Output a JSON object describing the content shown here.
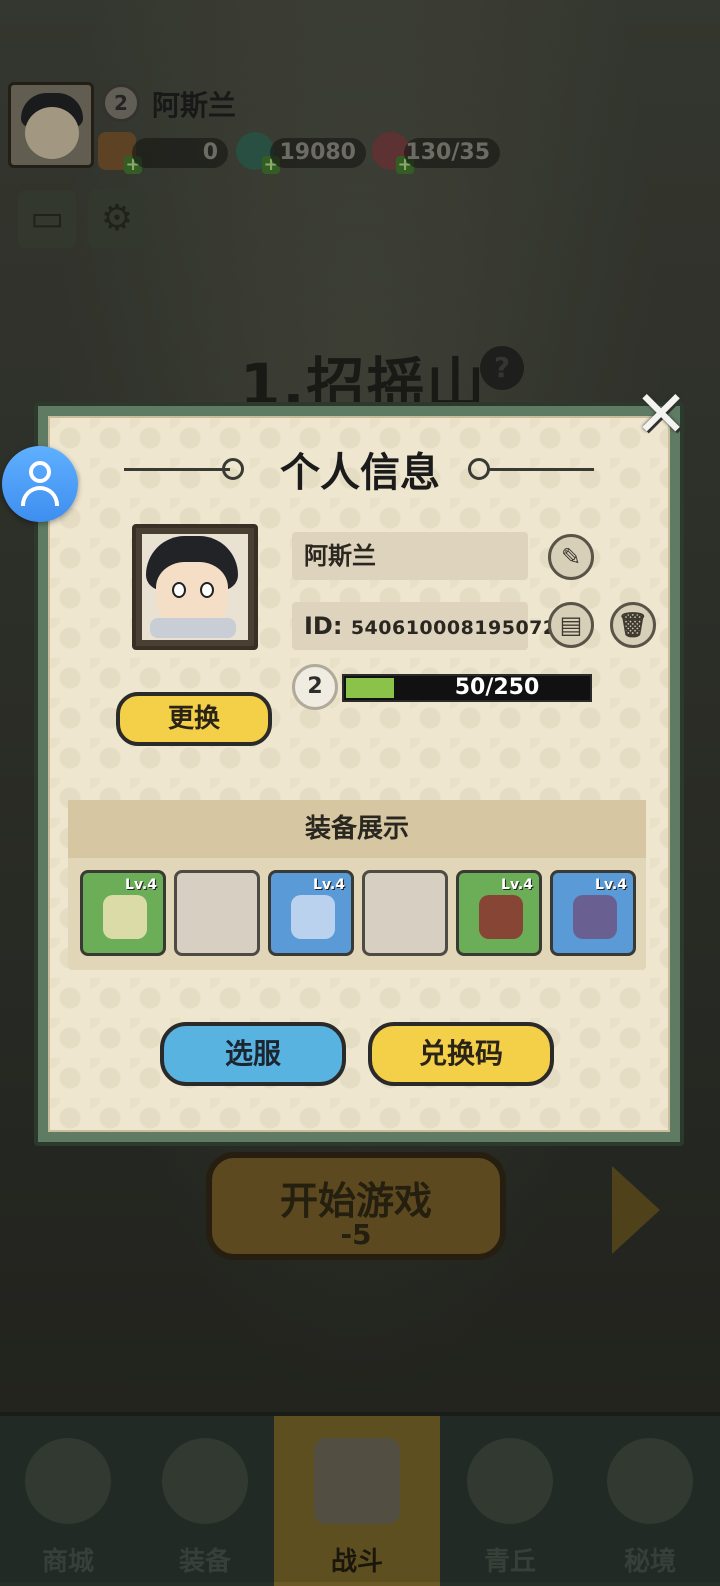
{
  "hud": {
    "player_name": "阿斯兰",
    "level": "2",
    "currency_1": "0",
    "currency_2": "19080",
    "stamina": "130/35"
  },
  "stage": {
    "title": "1.招摇山",
    "help_glyph": "?"
  },
  "start": {
    "label": "开始游戏",
    "cost": "-5"
  },
  "nav": [
    {
      "label": "商城"
    },
    {
      "label": "装备"
    },
    {
      "label": "战斗"
    },
    {
      "label": "青丘"
    },
    {
      "label": "秘境"
    }
  ],
  "dialog": {
    "title": "个人信息",
    "close_glyph": "✕",
    "name": "阿斯兰",
    "id_label": "ID:",
    "id_value": "540610008195072",
    "level": "2",
    "exp_text": "50/250",
    "exp_fraction": 0.2,
    "change_button": "更换",
    "equip_title": "装备展示",
    "slots": [
      {
        "rarity": "green",
        "level": "Lv.4",
        "icon": "scroll-item-icon"
      },
      {
        "rarity": "empty",
        "level": ""
      },
      {
        "rarity": "blue",
        "level": "Lv.4",
        "icon": "bracer-item-icon"
      },
      {
        "rarity": "empty",
        "level": ""
      },
      {
        "rarity": "green",
        "level": "Lv.4",
        "icon": "boots-item-icon"
      },
      {
        "rarity": "blue",
        "level": "Lv.4",
        "icon": "orb-item-icon"
      }
    ],
    "server_button": "选服",
    "code_button": "兑换码"
  },
  "colors": {
    "accent_yellow": "#f4cf48",
    "accent_blue": "#58b3e0",
    "frame_green": "#5f7b63",
    "exp_green": "#8bc34a"
  }
}
